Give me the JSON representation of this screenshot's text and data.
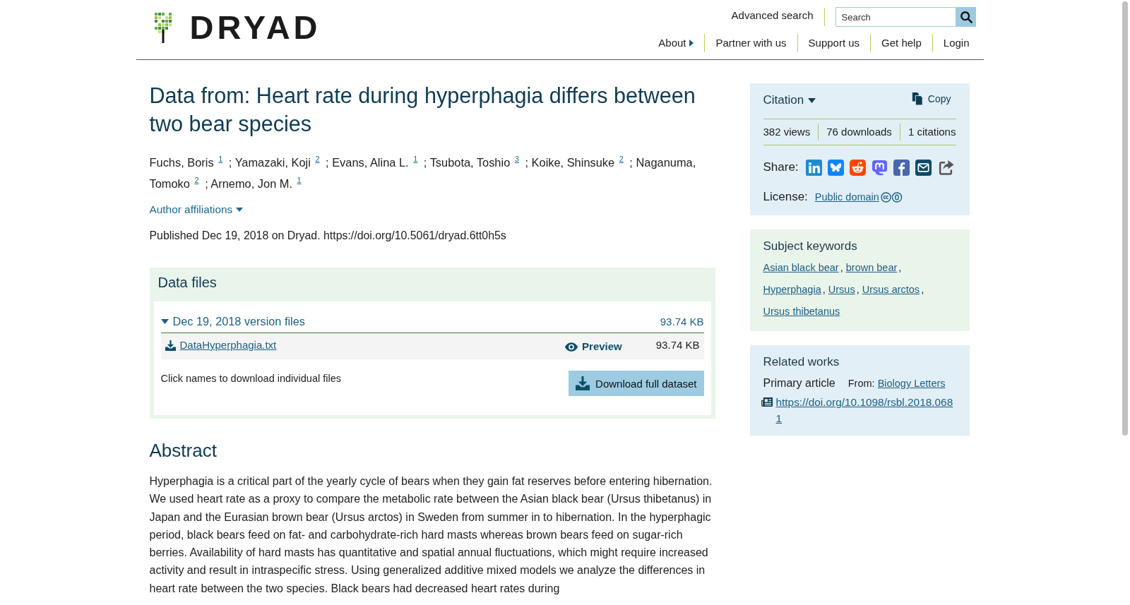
{
  "header": {
    "logo": "DRYAD",
    "advanced_search": "Advanced search",
    "search": {
      "placeholder": "Search"
    },
    "nav": [
      {
        "label": "About",
        "kind": "menu"
      },
      {
        "label": "Partner with us",
        "kind": "link"
      },
      {
        "label": "Support us",
        "kind": "link"
      },
      {
        "label": "Get help",
        "kind": "link"
      },
      {
        "label": "Login",
        "kind": "link"
      }
    ]
  },
  "dataset": {
    "title": "Data from: Heart rate during hyperphagia differs between two bear species",
    "authors": [
      {
        "name": "Fuchs, Boris",
        "affiliation": "1"
      },
      {
        "name": "Yamazaki, Koji",
        "affiliation": "2"
      },
      {
        "name": "Evans, Alina L.",
        "affiliation": "1"
      },
      {
        "name": "Tsubota, Toshio",
        "affiliation": "3"
      },
      {
        "name": "Koike, Shinsuke",
        "affiliation": "2"
      },
      {
        "name": "Naganuma, Tomoko",
        "affiliation": "2"
      },
      {
        "name": "Arnemo, Jon M.",
        "affiliation": "1"
      }
    ],
    "author_separator": ";",
    "affiliations_toggle": "Author affiliations",
    "published": "Published Dec 19, 2018 on Dryad. https://doi.org/10.5061/dryad.6tt0h5s"
  },
  "data_files": {
    "heading": "Data files",
    "version": {
      "label": "Dec 19, 2018 version files",
      "size": "93.74 KB",
      "expanded": true,
      "files": [
        {
          "name": "DataHyperphagia.txt",
          "preview": "Preview",
          "size": "93.74 KB"
        }
      ]
    },
    "hint": "Click names to download individual files",
    "download_button": "Download full dataset"
  },
  "abstract": {
    "heading": "Abstract",
    "text": "Hyperphagia is a critical part of the yearly cycle of bears when they gain fat reserves before entering hibernation. We used heart rate as a proxy to compare the metabolic rate between the Asian black bear (Ursus thibetanus) in Japan and the Eurasian brown bear (Ursus arctos) in Sweden from summer in to hibernation. In the hyperphagic period, black bears feed on fat- and carbohydrate-rich hard masts whereas brown bears feed on sugar-rich berries. Availability of hard masts has quantitative and spatial annual fluctuations, which might require increased activity and result in intraspecific stress. Using generalized additive mixed models we analyze the differences in heart rate between the two species. Black bears had decreased heart rates during"
  },
  "citation": {
    "heading": "Citation",
    "copy": "Copy",
    "stats": [
      "382 views",
      "76 downloads",
      "1 citations"
    ],
    "share_label": "Share:",
    "license_label": "License:",
    "license": "Public domain"
  },
  "keywords": {
    "heading": "Subject keywords",
    "items": [
      "Asian black bear",
      "brown bear",
      "Hyperphagia",
      "Ursus",
      "Ursus arctos",
      "Ursus thibetanus"
    ],
    "separator": ","
  },
  "related_works": {
    "heading": "Related works",
    "type": "Primary article",
    "from_label": "From:",
    "journal": "Biology Letters",
    "doi": "https://doi.org/10.1098/rsbl.2018.0681"
  }
}
